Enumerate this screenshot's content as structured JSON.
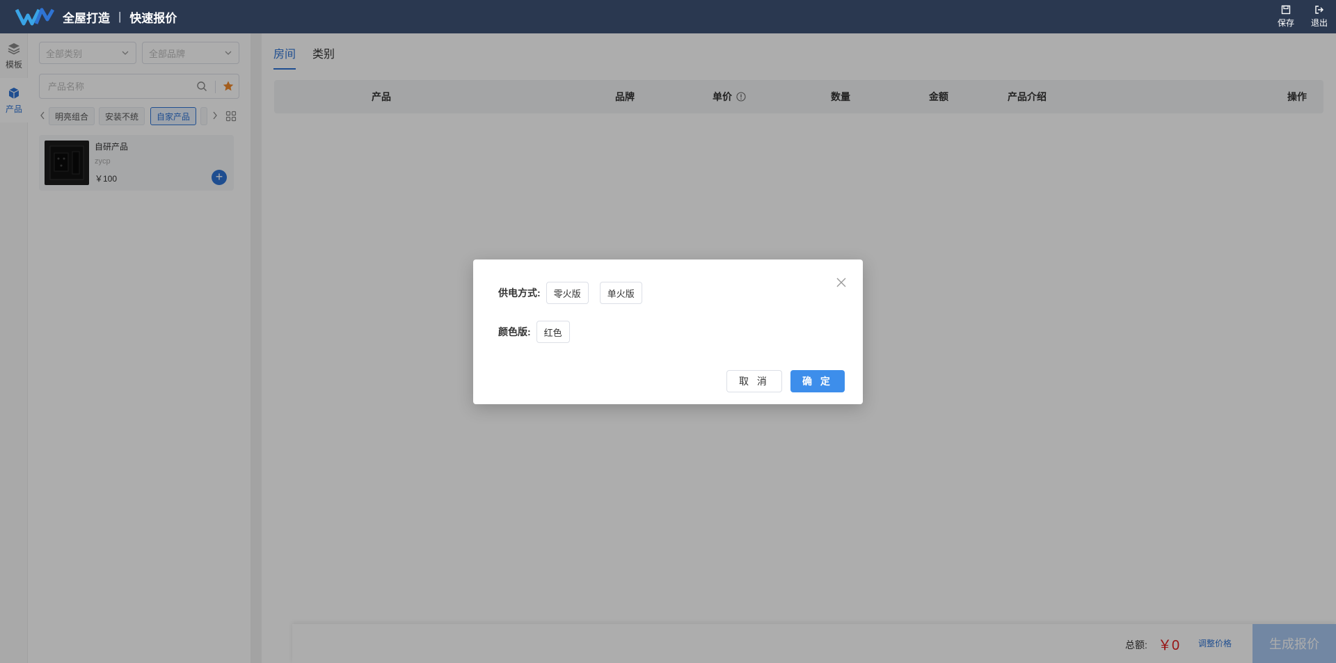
{
  "header": {
    "title": "全屋打造",
    "subtitle": "快速报价",
    "save_label": "保存",
    "exit_label": "退出",
    "bg_color": "#2a3850"
  },
  "rail": {
    "items": [
      {
        "label": "模板",
        "icon": "layers-icon"
      },
      {
        "label": "产品",
        "icon": "cube-icon",
        "active": true
      }
    ]
  },
  "filters": {
    "category_placeholder": "全部类别",
    "brand_placeholder": "全部品牌",
    "search_placeholder": "产品名称",
    "tags": [
      "明亮组合",
      "安装不统",
      "自家产品"
    ],
    "active_tag": "自家产品"
  },
  "products": [
    {
      "name": "自研产品",
      "code": "zycp",
      "price": "￥100"
    }
  ],
  "main": {
    "tabs": [
      "房间",
      "类别"
    ],
    "active_tab": "房间",
    "columns": [
      "产品",
      "品牌",
      "单价",
      "数量",
      "金额",
      "产品介绍",
      "操作"
    ]
  },
  "footer": {
    "total_label": "总额:",
    "total_value": "￥0",
    "adjust_label": "调整价格",
    "generate_label": "生成报价"
  },
  "modal": {
    "power_label": "供电方式:",
    "power_options": [
      "零火版",
      "单火版"
    ],
    "color_label": "颜色版:",
    "color_options": [
      "红色"
    ],
    "cancel_label": "取 消",
    "ok_label": "确 定"
  },
  "colors": {
    "accent": "#2f74d4",
    "primary_button": "#3d8eeb",
    "price_red": "#e02020",
    "favorite_orange": "#f0892b"
  }
}
